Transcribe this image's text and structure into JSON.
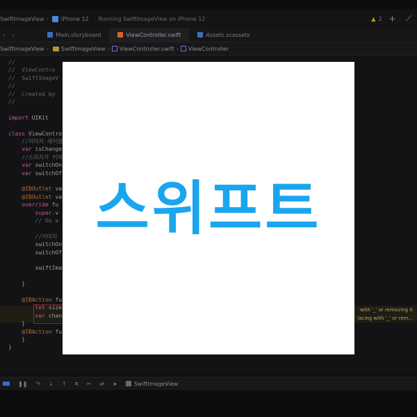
{
  "toolbar": {
    "project": "SwiftImageView",
    "device": "iPhone 12",
    "status": "Running SwiftImageView on iPhone 12",
    "warning_count": "2"
  },
  "tabs": [
    {
      "label": "Main.storyboard"
    },
    {
      "label": "ViewController.swift"
    },
    {
      "label": "Assets.xcassets"
    }
  ],
  "jumpbar": {
    "items": [
      "SwiftImageView",
      "SwiftImageView",
      "ViewController.swift",
      "ViewController"
    ]
  },
  "code": {
    "lines": [
      "//",
      "//  ViewContro",
      "//  SwiftImageV",
      "//",
      "//  Created by",
      "//",
      "",
      "import UIKit",
      "",
      "class ViewContro",
      "    //이미지 세어졌",
      "    var isChange",
      "    //스위치가 커져",
      "    var switchOn",
      "    var switchOf",
      "",
      "    @IBOutlet va",
      "    @IBOutlet va",
      "    override fu",
      "        super.v",
      "        // Do a",
      "",
      "        //이미지",
      "        switchOn",
      "        switchOf",
      "",
      "        swiftIma",
      "",
      "    }",
      "",
      "    @IBAction fu",
      "        let size",
      "        var chan",
      "    }",
      "    @IBAction fu",
      "    }",
      "}"
    ],
    "issues": [
      "with '_' or removing it",
      "lacing with '_' or rem..."
    ]
  },
  "debug": {
    "app_name": "SwiftImageView"
  },
  "logo": {
    "text": "스위프트",
    "color": "#1aa6ee"
  }
}
